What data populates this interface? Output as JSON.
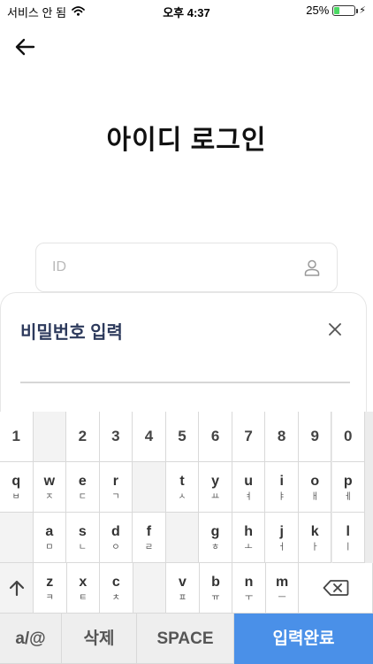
{
  "status_bar": {
    "carrier": "서비스 안 됨",
    "time": "오후 4:37",
    "battery_pct": "25%",
    "battery_level": 0.25
  },
  "header": {
    "back_icon": "arrow-left-icon",
    "title": "아이디 로그인"
  },
  "id_field": {
    "placeholder": "ID",
    "value": "",
    "icon": "user-icon"
  },
  "password_sheet": {
    "title": "비밀번호 입력",
    "close_icon": "close-icon",
    "value": ""
  },
  "keyboard": {
    "number_row": [
      "1",
      "",
      "2",
      "3",
      "4",
      "5",
      "6",
      "7",
      "8",
      "9",
      "0"
    ],
    "row1": [
      {
        "main": "q",
        "sub": "ㅂ"
      },
      {
        "main": "w",
        "sub": "ㅈ"
      },
      {
        "main": "e",
        "sub": "ㄷ"
      },
      {
        "main": "r",
        "sub": "ㄱ"
      },
      {
        "main": "",
        "sub": ""
      },
      {
        "main": "t",
        "sub": "ㅅ"
      },
      {
        "main": "y",
        "sub": "ㅛ"
      },
      {
        "main": "u",
        "sub": "ㅕ"
      },
      {
        "main": "i",
        "sub": "ㅑ"
      },
      {
        "main": "o",
        "sub": "ㅐ"
      },
      {
        "main": "p",
        "sub": "ㅔ"
      }
    ],
    "row2": [
      {
        "main": "",
        "sub": ""
      },
      {
        "main": "a",
        "sub": "ㅁ"
      },
      {
        "main": "s",
        "sub": "ㄴ"
      },
      {
        "main": "d",
        "sub": "ㅇ"
      },
      {
        "main": "f",
        "sub": "ㄹ"
      },
      {
        "main": "",
        "sub": ""
      },
      {
        "main": "g",
        "sub": "ㅎ"
      },
      {
        "main": "h",
        "sub": "ㅗ"
      },
      {
        "main": "j",
        "sub": "ㅓ"
      },
      {
        "main": "k",
        "sub": "ㅏ"
      },
      {
        "main": "l",
        "sub": "ㅣ"
      }
    ],
    "row3": [
      {
        "main": "z",
        "sub": "ㅋ"
      },
      {
        "main": "x",
        "sub": "ㅌ"
      },
      {
        "main": "c",
        "sub": "ㅊ"
      },
      {
        "main": "",
        "sub": ""
      },
      {
        "main": "v",
        "sub": "ㅍ"
      },
      {
        "main": "b",
        "sub": "ㅠ"
      },
      {
        "main": "n",
        "sub": "ㅜ"
      },
      {
        "main": "m",
        "sub": "ㅡ"
      }
    ],
    "shift_icon": "arrow-up-icon",
    "backspace_icon": "backspace-icon",
    "mode_label": "a/@",
    "delete_label": "삭제",
    "space_label": "SPACE",
    "done_label": "입력완료",
    "done_color": "#4a90e8"
  }
}
